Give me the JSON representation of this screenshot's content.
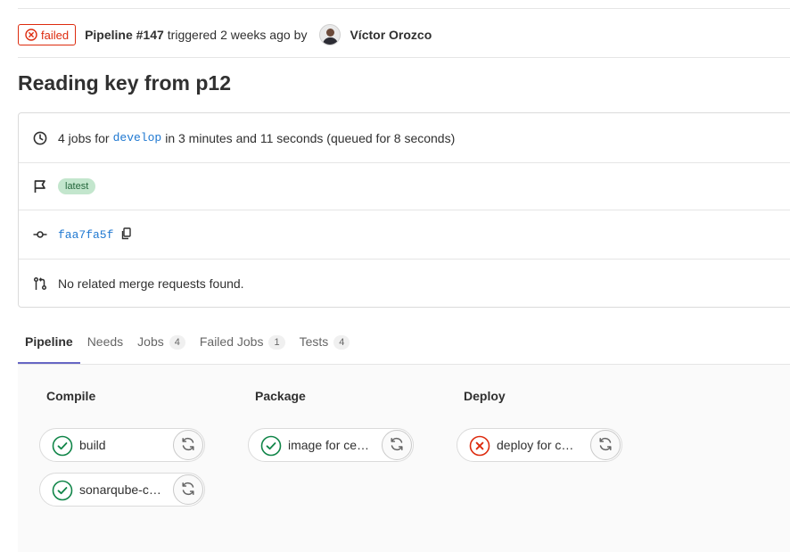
{
  "header": {
    "status": "failed",
    "pipeline": "Pipeline #147",
    "triggered": "triggered",
    "time_ago": "2 weeks ago",
    "by": "by",
    "author": "Víctor Orozco"
  },
  "title": "Reading key from p12",
  "info": {
    "jobs_count": "4 jobs for",
    "branch": "develop",
    "duration": "in 3 minutes and 11 seconds (queued for 8 seconds)",
    "tag": "latest",
    "commit": "faa7fa5f",
    "merge_requests": "No related merge requests found."
  },
  "tabs": [
    {
      "label": "Pipeline",
      "count": ""
    },
    {
      "label": "Needs",
      "count": ""
    },
    {
      "label": "Jobs",
      "count": "4"
    },
    {
      "label": "Failed Jobs",
      "count": "1"
    },
    {
      "label": "Tests",
      "count": "4"
    }
  ],
  "stages": [
    {
      "name": "Compile",
      "jobs": [
        {
          "name": "build",
          "status": "success"
        },
        {
          "name": "sonarqube-c…",
          "status": "success"
        }
      ]
    },
    {
      "name": "Package",
      "jobs": [
        {
          "name": "image for cer…",
          "status": "success"
        }
      ]
    },
    {
      "name": "Deploy",
      "jobs": [
        {
          "name": "deploy for cer…",
          "status": "failed"
        }
      ]
    }
  ],
  "colors": {
    "failed": "#dd2b0e",
    "success": "#108548",
    "link": "#1f78d1",
    "tab_active": "#6666c4"
  }
}
